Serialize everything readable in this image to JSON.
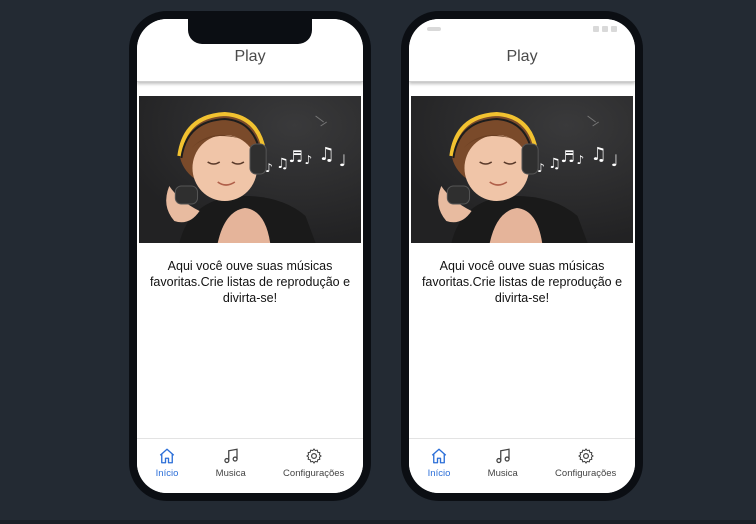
{
  "phones": [
    {
      "header": {
        "title": "Play"
      },
      "content": {
        "description": "Aqui você ouve suas músicas favoritas.Crie listas de reprodução e divirta-se!"
      },
      "tabs": [
        {
          "label": "Início",
          "icon": "home-icon",
          "active": true
        },
        {
          "label": "Musica",
          "icon": "music-note-icon",
          "active": false
        },
        {
          "label": "Configurações",
          "icon": "gear-icon",
          "active": false
        }
      ]
    },
    {
      "header": {
        "title": "Play"
      },
      "content": {
        "description": "Aqui você ouve suas músicas favoritas.Crie listas de reprodução e divirta-se!"
      },
      "tabs": [
        {
          "label": "Início",
          "icon": "home-icon",
          "active": true
        },
        {
          "label": "Musica",
          "icon": "music-note-icon",
          "active": false
        },
        {
          "label": "Configurações",
          "icon": "gear-icon",
          "active": false
        }
      ]
    }
  ],
  "colors": {
    "background": "#232a33",
    "phone_frame": "#0b0e13",
    "active_tab": "#2c6fd8",
    "inactive_tab": "#444444"
  }
}
